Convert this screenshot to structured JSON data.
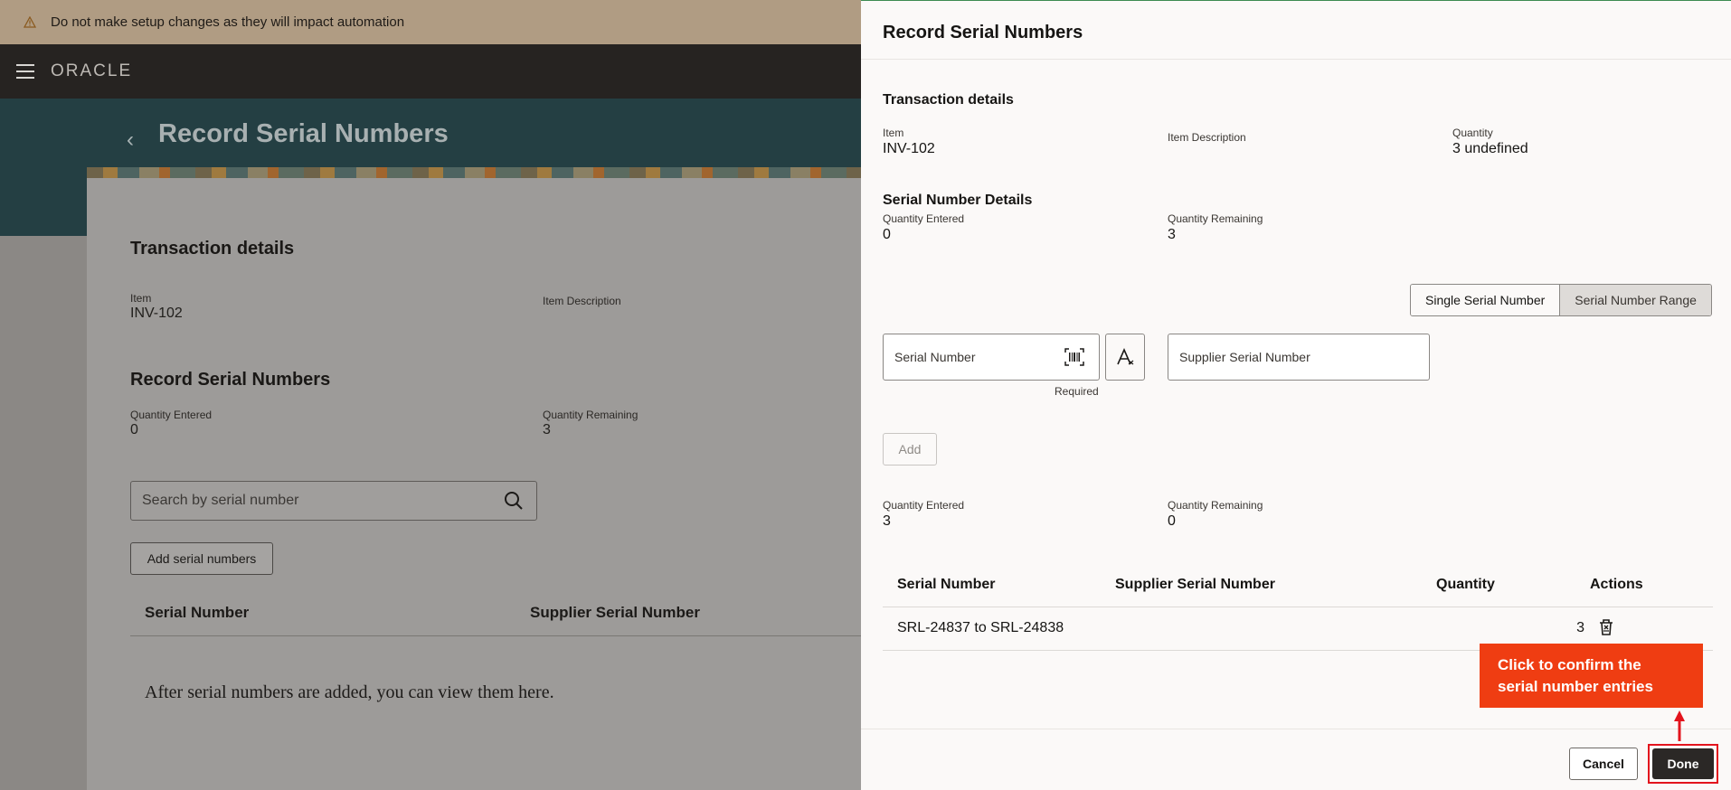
{
  "banner": {
    "text": "Do not make setup changes as they will impact automation"
  },
  "topbar": {
    "logo": "ORACLE"
  },
  "page": {
    "title": "Record Serial Numbers",
    "transaction_heading": "Transaction details",
    "item_label": "Item",
    "item_value": "INV-102",
    "item_desc_label": "Item Description",
    "record_heading": "Record Serial Numbers",
    "qty_entered_label": "Quantity Entered",
    "qty_entered_value": "0",
    "qty_remaining_label": "Quantity Remaining",
    "qty_remaining_value": "3",
    "search_placeholder": "Search by serial number",
    "add_button": "Add serial numbers",
    "columns": [
      "Serial Number",
      "Supplier Serial Number"
    ],
    "empty_text": "After serial numbers are added, you can view them here."
  },
  "drawer": {
    "title": "Record Serial Numbers",
    "transaction_heading": "Transaction details",
    "item_label": "Item",
    "item_value": "INV-102",
    "item_desc_label": "Item Description",
    "quantity_label": "Quantity",
    "quantity_value": "3 undefined",
    "serial_details_heading": "Serial Number Details",
    "qty_entered_label": "Quantity Entered",
    "qty_entered_value": "0",
    "qty_remaining_label": "Quantity Remaining",
    "qty_remaining_value": "3",
    "mode_single": "Single Serial Number",
    "mode_range": "Serial Number Range",
    "serial_placeholder": "Serial Number",
    "required_text": "Required",
    "supplier_placeholder": "Supplier Serial Number",
    "add_button": "Add",
    "qty_entered_label2": "Quantity Entered",
    "qty_entered_value2": "3",
    "qty_remaining_label2": "Quantity Remaining",
    "qty_remaining_value2": "0",
    "table": {
      "columns": [
        "Serial Number",
        "Supplier Serial Number",
        "Quantity",
        "Actions"
      ],
      "rows": [
        {
          "serial": "SRL-24837 to SRL-24838",
          "supplier": "",
          "quantity": "3"
        }
      ]
    },
    "cancel_button": "Cancel",
    "done_button": "Done"
  },
  "callout": {
    "text": "Click to confirm the serial number entries"
  },
  "colors": {
    "callout": "#ef3d12",
    "highlight": "#e3141d",
    "done": "#2b2826"
  }
}
